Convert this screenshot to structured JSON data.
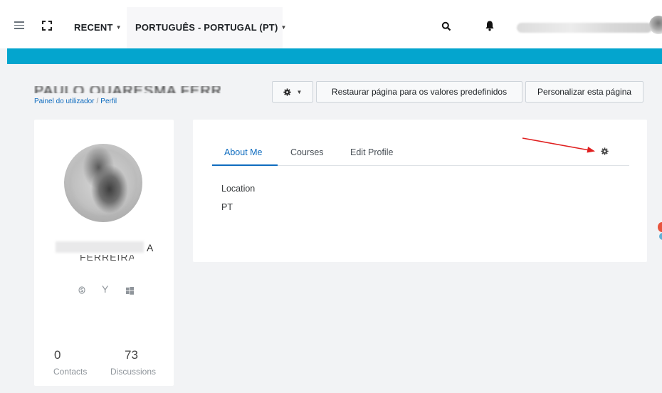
{
  "navbar": {
    "recent_label": "RECENT",
    "language_label": "PORTUGUÊS - PORTUGAL (PT)",
    "icons": [
      "menu-icon",
      "expand-icon",
      "search-icon",
      "bell-icon"
    ]
  },
  "header": {
    "user_name": "PAULO QUARESMA FERREIRA",
    "breadcrumb": [
      "Painel do utilizador",
      "Perfil"
    ],
    "reset_button": "Restaurar página para os valores predefinidos",
    "customise_button": "Personalizar esta página"
  },
  "profile_card": {
    "name_line1_tail": "A",
    "name_line2": "FERREIRA",
    "social_icons": [
      "skype-icon",
      "yahoo-icon",
      "windows-icon"
    ],
    "contacts_count": "0",
    "contacts_label": "Contacts",
    "discussions_count": "73",
    "discussions_label": "Discussions"
  },
  "tabs": [
    {
      "label": "About Me",
      "active": true
    },
    {
      "label": "Courses",
      "active": false
    },
    {
      "label": "Edit Profile",
      "active": false
    }
  ],
  "about": {
    "location_label": "Location",
    "location_value": "PT"
  },
  "colors": {
    "accent": "#04a5ce",
    "link": "#0f6cbf",
    "arrow": "#e02020"
  }
}
